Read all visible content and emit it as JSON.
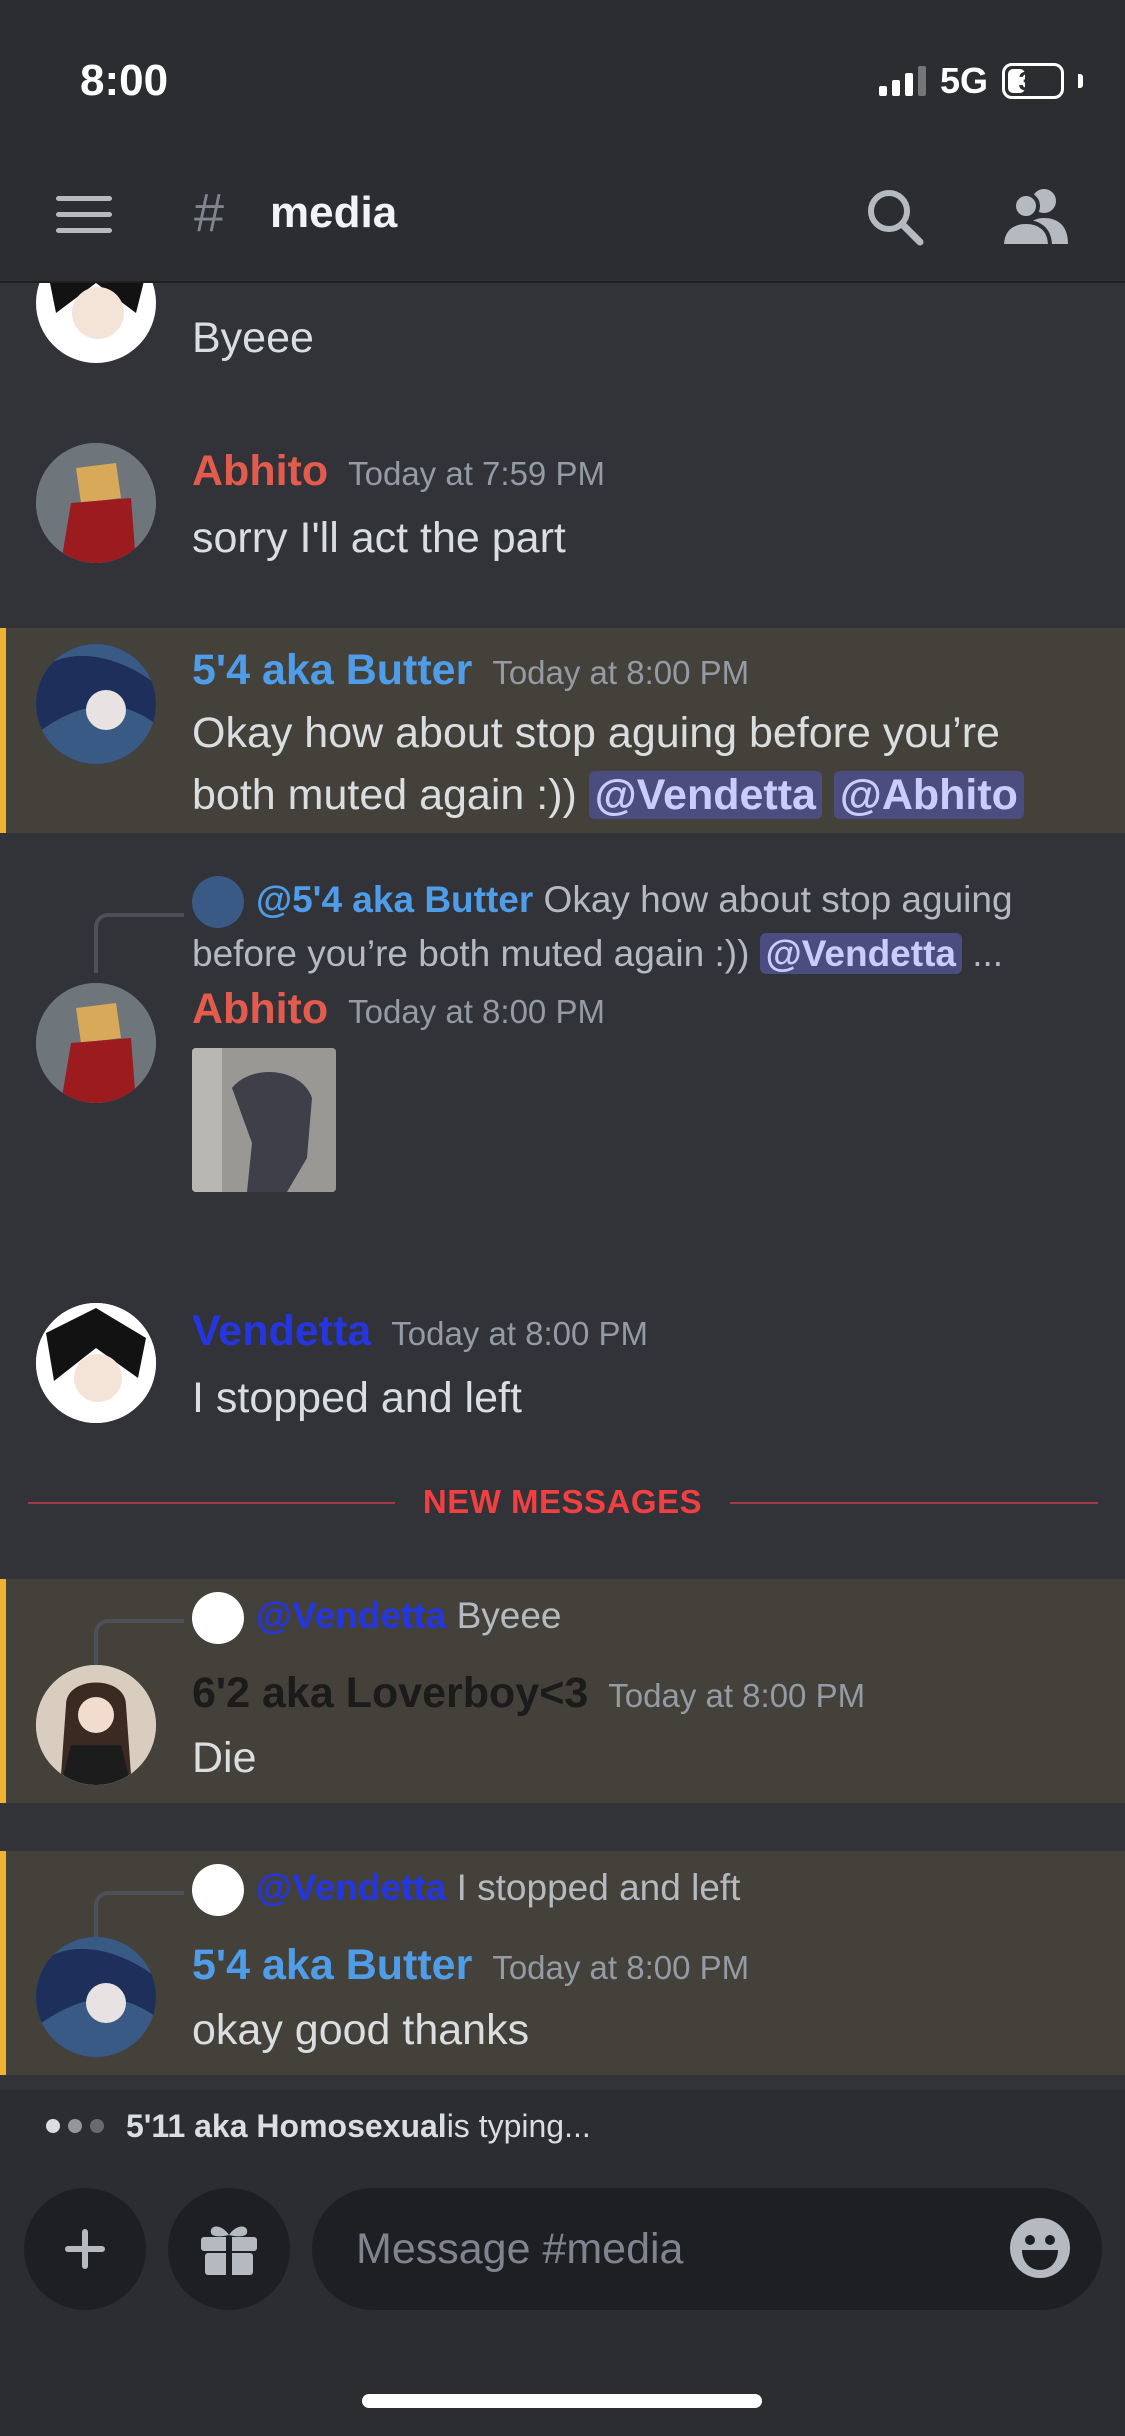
{
  "status_bar": {
    "time": "8:00",
    "network": "5G",
    "battery": "34"
  },
  "header": {
    "hash": "#",
    "channel": "media"
  },
  "colors": {
    "abhito": "#e25b4c",
    "butter": "#4f9de8",
    "vendetta": "#2536e0",
    "loverboy": "#1b1b1b",
    "mention_bg": "#44413a",
    "mention_bar": "#f0b232",
    "new_messages": "#f23f42"
  },
  "messages": [
    {
      "author": "",
      "time": "",
      "text": "Byeee"
    },
    {
      "author": "Abhito",
      "time": "Today at 7:59 PM",
      "text": "sorry I'll act the part"
    },
    {
      "author": "5'4 aka Butter",
      "time": "Today at 8:00 PM",
      "text": "Okay how about stop aguing before you’re both muted again :)) ",
      "mentions": [
        "@Vendetta",
        "@Abhito"
      ]
    },
    {
      "reply": {
        "name": "@5'4 aka Butter",
        "line1": "Okay how about stop aguing",
        "line2": "before you’re both muted again :))",
        "mention": "@Vendetta",
        "ellipsis": "..."
      },
      "author": "Abhito",
      "time": "Today at 8:00 PM",
      "attachment": "image"
    },
    {
      "author": "Vendetta",
      "time": "Today at 8:00 PM",
      "text": "I stopped and left"
    },
    {
      "reply": {
        "name": "@Vendetta",
        "text": "Byeee"
      },
      "author": "6'2 aka Loverboy<3",
      "time": "Today at 8:00 PM",
      "text": "Die"
    },
    {
      "reply": {
        "name": "@Vendetta",
        "text": "I stopped and left"
      },
      "author": "5'4 aka Butter",
      "time": "Today at 8:00 PM",
      "text": "okay good thanks"
    }
  ],
  "divider": {
    "label": "NEW MESSAGES"
  },
  "typing": {
    "user": "5'11 aka Homosexual",
    "suffix": " is typing..."
  },
  "composer": {
    "placeholder": "Message #media"
  },
  "icons": [
    "menu-icon",
    "hash-icon",
    "search-icon",
    "members-icon",
    "plus-icon",
    "gift-icon",
    "emoji-icon"
  ]
}
